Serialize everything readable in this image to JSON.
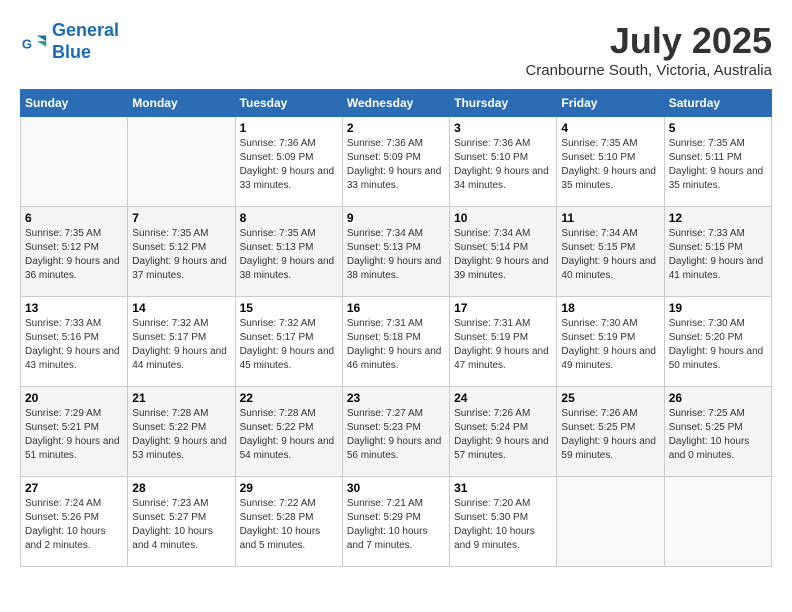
{
  "logo": {
    "line1": "General",
    "line2": "Blue"
  },
  "title": "July 2025",
  "location": "Cranbourne South, Victoria, Australia",
  "days_header": [
    "Sunday",
    "Monday",
    "Tuesday",
    "Wednesday",
    "Thursday",
    "Friday",
    "Saturday"
  ],
  "weeks": [
    [
      {
        "day": "",
        "info": ""
      },
      {
        "day": "",
        "info": ""
      },
      {
        "day": "1",
        "info": "Sunrise: 7:36 AM\nSunset: 5:09 PM\nDaylight: 9 hours and 33 minutes."
      },
      {
        "day": "2",
        "info": "Sunrise: 7:36 AM\nSunset: 5:09 PM\nDaylight: 9 hours and 33 minutes."
      },
      {
        "day": "3",
        "info": "Sunrise: 7:36 AM\nSunset: 5:10 PM\nDaylight: 9 hours and 34 minutes."
      },
      {
        "day": "4",
        "info": "Sunrise: 7:35 AM\nSunset: 5:10 PM\nDaylight: 9 hours and 35 minutes."
      },
      {
        "day": "5",
        "info": "Sunrise: 7:35 AM\nSunset: 5:11 PM\nDaylight: 9 hours and 35 minutes."
      }
    ],
    [
      {
        "day": "6",
        "info": "Sunrise: 7:35 AM\nSunset: 5:12 PM\nDaylight: 9 hours and 36 minutes."
      },
      {
        "day": "7",
        "info": "Sunrise: 7:35 AM\nSunset: 5:12 PM\nDaylight: 9 hours and 37 minutes."
      },
      {
        "day": "8",
        "info": "Sunrise: 7:35 AM\nSunset: 5:13 PM\nDaylight: 9 hours and 38 minutes."
      },
      {
        "day": "9",
        "info": "Sunrise: 7:34 AM\nSunset: 5:13 PM\nDaylight: 9 hours and 38 minutes."
      },
      {
        "day": "10",
        "info": "Sunrise: 7:34 AM\nSunset: 5:14 PM\nDaylight: 9 hours and 39 minutes."
      },
      {
        "day": "11",
        "info": "Sunrise: 7:34 AM\nSunset: 5:15 PM\nDaylight: 9 hours and 40 minutes."
      },
      {
        "day": "12",
        "info": "Sunrise: 7:33 AM\nSunset: 5:15 PM\nDaylight: 9 hours and 41 minutes."
      }
    ],
    [
      {
        "day": "13",
        "info": "Sunrise: 7:33 AM\nSunset: 5:16 PM\nDaylight: 9 hours and 43 minutes."
      },
      {
        "day": "14",
        "info": "Sunrise: 7:32 AM\nSunset: 5:17 PM\nDaylight: 9 hours and 44 minutes."
      },
      {
        "day": "15",
        "info": "Sunrise: 7:32 AM\nSunset: 5:17 PM\nDaylight: 9 hours and 45 minutes."
      },
      {
        "day": "16",
        "info": "Sunrise: 7:31 AM\nSunset: 5:18 PM\nDaylight: 9 hours and 46 minutes."
      },
      {
        "day": "17",
        "info": "Sunrise: 7:31 AM\nSunset: 5:19 PM\nDaylight: 9 hours and 47 minutes."
      },
      {
        "day": "18",
        "info": "Sunrise: 7:30 AM\nSunset: 5:19 PM\nDaylight: 9 hours and 49 minutes."
      },
      {
        "day": "19",
        "info": "Sunrise: 7:30 AM\nSunset: 5:20 PM\nDaylight: 9 hours and 50 minutes."
      }
    ],
    [
      {
        "day": "20",
        "info": "Sunrise: 7:29 AM\nSunset: 5:21 PM\nDaylight: 9 hours and 51 minutes."
      },
      {
        "day": "21",
        "info": "Sunrise: 7:28 AM\nSunset: 5:22 PM\nDaylight: 9 hours and 53 minutes."
      },
      {
        "day": "22",
        "info": "Sunrise: 7:28 AM\nSunset: 5:22 PM\nDaylight: 9 hours and 54 minutes."
      },
      {
        "day": "23",
        "info": "Sunrise: 7:27 AM\nSunset: 5:23 PM\nDaylight: 9 hours and 56 minutes."
      },
      {
        "day": "24",
        "info": "Sunrise: 7:26 AM\nSunset: 5:24 PM\nDaylight: 9 hours and 57 minutes."
      },
      {
        "day": "25",
        "info": "Sunrise: 7:26 AM\nSunset: 5:25 PM\nDaylight: 9 hours and 59 minutes."
      },
      {
        "day": "26",
        "info": "Sunrise: 7:25 AM\nSunset: 5:25 PM\nDaylight: 10 hours and 0 minutes."
      }
    ],
    [
      {
        "day": "27",
        "info": "Sunrise: 7:24 AM\nSunset: 5:26 PM\nDaylight: 10 hours and 2 minutes."
      },
      {
        "day": "28",
        "info": "Sunrise: 7:23 AM\nSunset: 5:27 PM\nDaylight: 10 hours and 4 minutes."
      },
      {
        "day": "29",
        "info": "Sunrise: 7:22 AM\nSunset: 5:28 PM\nDaylight: 10 hours and 5 minutes."
      },
      {
        "day": "30",
        "info": "Sunrise: 7:21 AM\nSunset: 5:29 PM\nDaylight: 10 hours and 7 minutes."
      },
      {
        "day": "31",
        "info": "Sunrise: 7:20 AM\nSunset: 5:30 PM\nDaylight: 10 hours and 9 minutes."
      },
      {
        "day": "",
        "info": ""
      },
      {
        "day": "",
        "info": ""
      }
    ]
  ]
}
